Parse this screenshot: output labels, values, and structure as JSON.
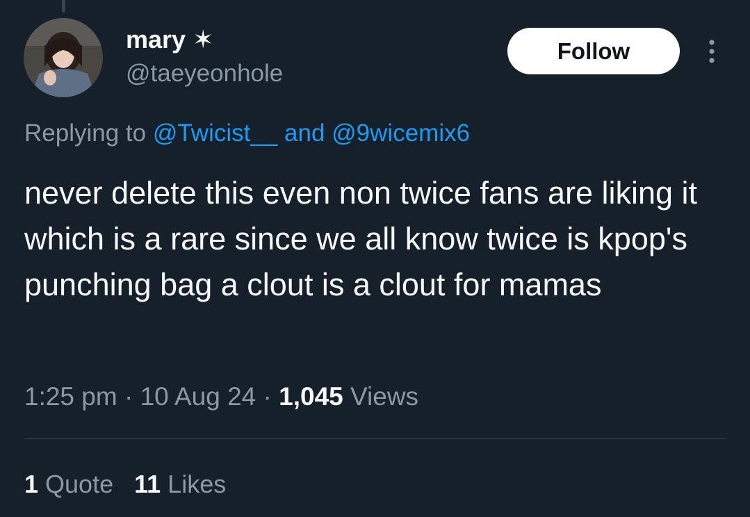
{
  "author": {
    "display_name": "mary",
    "badge_glyph": "✶",
    "handle": "@taeyeonhole",
    "avatar_icon": "user-photo-avatar"
  },
  "header": {
    "follow_label": "Follow",
    "more_icon": "more-vertical-icon"
  },
  "reply": {
    "prefix": "Replying to ",
    "mention_1": "@Twicist__",
    "joiner": " and ",
    "mention_2": "@9wicemix6"
  },
  "tweet": {
    "text": "never delete this even non twice fans are liking it which is a rare since we all know twice is kpop's punching bag a clout is a clout for mamas"
  },
  "meta": {
    "time": "1:25 pm",
    "sep1": " · ",
    "date": "10 Aug 24",
    "sep2": " · ",
    "views_count": "1,045",
    "views_label": " Views"
  },
  "stats": {
    "quotes_count": "1",
    "quotes_label": " Quote",
    "likes_count": "11",
    "likes_label": " Likes"
  },
  "colors": {
    "background": "#15202b",
    "link": "#1d9bf0",
    "secondary_text": "#8b98a5",
    "primary_text": "#f7f9f9"
  }
}
